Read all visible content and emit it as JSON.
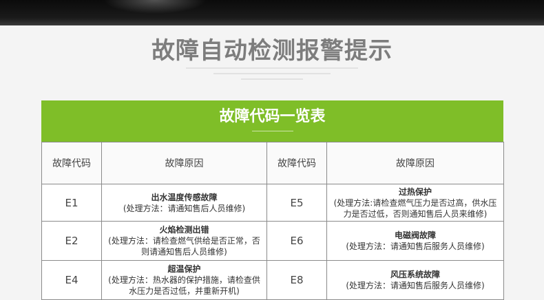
{
  "page": {
    "title": "故障自动检测报警提示"
  },
  "table": {
    "title": "故障代码一览表",
    "headers": [
      "故障代码",
      "故障原因",
      "故障代码",
      "故障原因"
    ],
    "rows": [
      {
        "left": {
          "code": "E1",
          "title": "出水温度传感故障",
          "text": "(处理方法：请通知售后人员维修)"
        },
        "right": {
          "code": "E5",
          "title": "过热保护",
          "text": "(处理方法:请检查燃气压力是否过高，供水压力是否过低，否则通知售后人员来维修)"
        }
      },
      {
        "left": {
          "code": "E2",
          "title": "火焰检测出错",
          "text": "(处理方法：请检查燃气供给是否正常，否则请通知售后人员维修)"
        },
        "right": {
          "code": "E6",
          "title": "电磁阀故障",
          "text": "(处理方法：请通知售后服务人员维修)"
        }
      },
      {
        "left": {
          "code": "E4",
          "title": "超温保护",
          "text": "(处理方法：热水器的保护措施，请检查供水压力是否过低，并重新开机)"
        },
        "right": {
          "code": "E8",
          "title": "风压系统故障",
          "text": "(处理方法：请通知售后服务人员维修)"
        }
      }
    ]
  },
  "colors": {
    "accent_green": "#7fbe28",
    "title_gray": "#7d7d7d",
    "border": "#8a8a8a"
  }
}
